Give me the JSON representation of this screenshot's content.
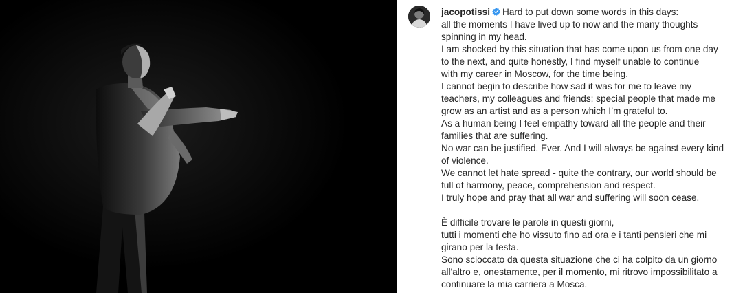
{
  "post": {
    "username": "jacopotissi",
    "verified": true,
    "first_line": "Hard to put down some words in this days:",
    "caption_lines": [
      "all the moments I have lived up to now and the many thoughts",
      "spinning in my head.",
      "I am shocked by this situation that has come upon us from one day",
      "to the next, and quite honestly, I find myself unable to continue",
      "with my career in Moscow, for the time being.",
      "I cannot begin to describe how sad it was for me to leave my",
      "teachers, my colleagues and friends; special people that made me",
      "grow as an artist and as a person which I’m grateful to.",
      "As a human being I feel empathy toward all the people and their",
      "families that are suffering.",
      "No war can be justified. Ever. And I will always be against every kind",
      "of violence.",
      "We cannot let hate spread - quite the contrary, our world should be",
      "full of harmony, peace, comprehension and respect.",
      "I truly hope and pray that all war and suffering will soon cease.",
      "",
      "È difficile trovare le parole in questi giorni,",
      "tutti i momenti che ho vissuto fino ad ora e i tanti pensieri che mi",
      "girano per la testa.",
      "Sono scioccato da questa situazione che ci ha colpito da un giorno",
      "all'altro e, onestamente, per il momento, mi ritrovo impossibilitato a",
      "continuare la mia carriera a Mosca."
    ]
  },
  "icons": {
    "verified": "verified-badge-icon",
    "avatar": "profile-avatar"
  },
  "colors": {
    "text": "#262626",
    "verified": "#3897f0",
    "photo_bg": "#000000",
    "divider": "#dbdbdb"
  }
}
